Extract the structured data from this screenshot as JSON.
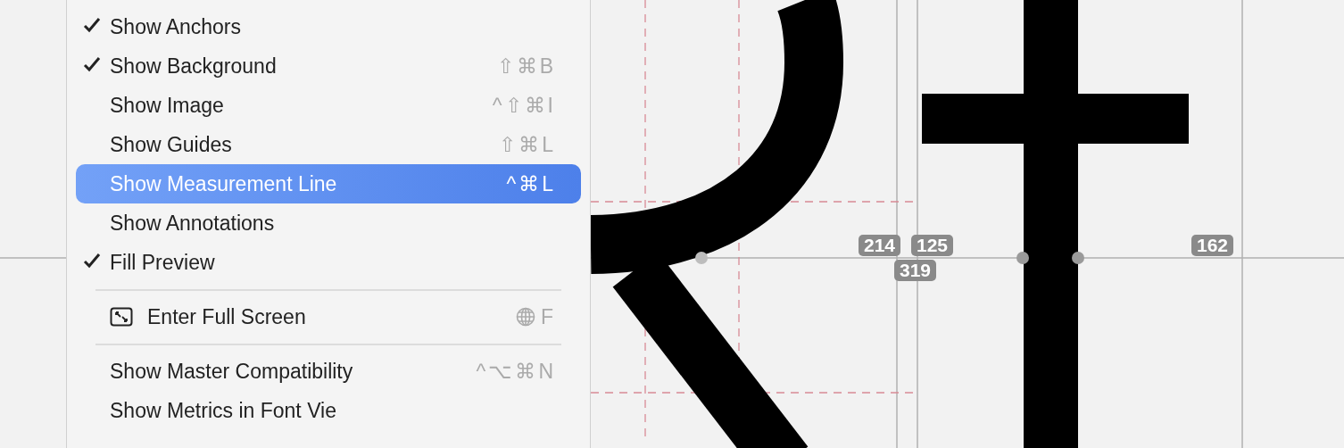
{
  "menu": {
    "items": [
      {
        "kind": "item",
        "label": "Show Anchors",
        "checked": true,
        "selected": false
      },
      {
        "kind": "item",
        "label": "Show Background",
        "checked": true,
        "selected": false,
        "shortcut": "⇧⌘B"
      },
      {
        "kind": "item",
        "label": "Show Image",
        "checked": false,
        "selected": false,
        "shortcut": "^⇧⌘I"
      },
      {
        "kind": "item",
        "label": "Show Guides",
        "checked": false,
        "selected": false,
        "shortcut": "⇧⌘L"
      },
      {
        "kind": "item",
        "label": "Show Measurement Line",
        "checked": false,
        "selected": true,
        "shortcut": "^⌘L"
      },
      {
        "kind": "item",
        "label": "Show Annotations",
        "checked": false,
        "selected": false
      },
      {
        "kind": "item",
        "label": "Fill Preview",
        "checked": true,
        "selected": false
      },
      {
        "kind": "separator"
      },
      {
        "kind": "fullscreen",
        "label": "Enter Full Screen",
        "checked": false,
        "selected": false,
        "shortcut": "F"
      },
      {
        "kind": "separator"
      },
      {
        "kind": "item",
        "label": "Show Master Compatibility",
        "checked": false,
        "selected": false,
        "shortcut": "^⌥⌘N"
      },
      {
        "kind": "item",
        "label": "Show Metrics in Font Vie",
        "checked": false,
        "selected": false
      }
    ]
  },
  "canvas": {
    "measurements": [
      "214",
      "125",
      "319",
      "162"
    ]
  }
}
